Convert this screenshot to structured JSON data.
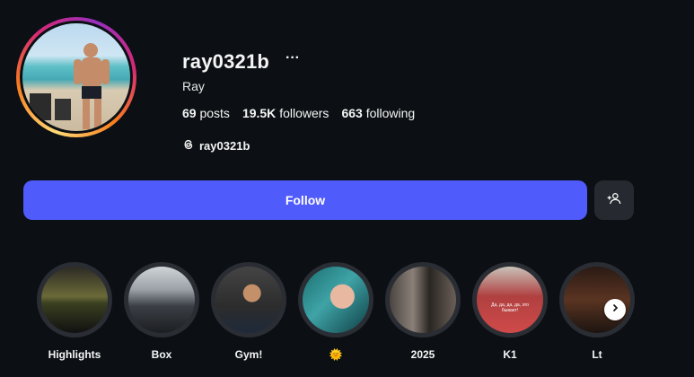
{
  "profile": {
    "username": "ray0321b",
    "more_label": "···",
    "full_name": "Ray",
    "stats": {
      "posts_count": "69",
      "posts_label": "posts",
      "followers_count": "19.5K",
      "followers_label": "followers",
      "following_count": "663",
      "following_label": "following"
    },
    "threads_handle": "ray0321b"
  },
  "actions": {
    "follow_label": "Follow",
    "add_user_icon": "add-user-icon",
    "accent": "#4f5bfa"
  },
  "highlights": [
    {
      "label": "Highlights"
    },
    {
      "label": "Box"
    },
    {
      "label": "Gym!"
    },
    {
      "label": "🌞"
    },
    {
      "label": "2025"
    },
    {
      "label": "K1"
    },
    {
      "label": "Lt"
    }
  ],
  "highlight_pic_text": "Да, да, да, да, это бывает!",
  "nav": {
    "next_icon": "chevron-right-icon"
  }
}
